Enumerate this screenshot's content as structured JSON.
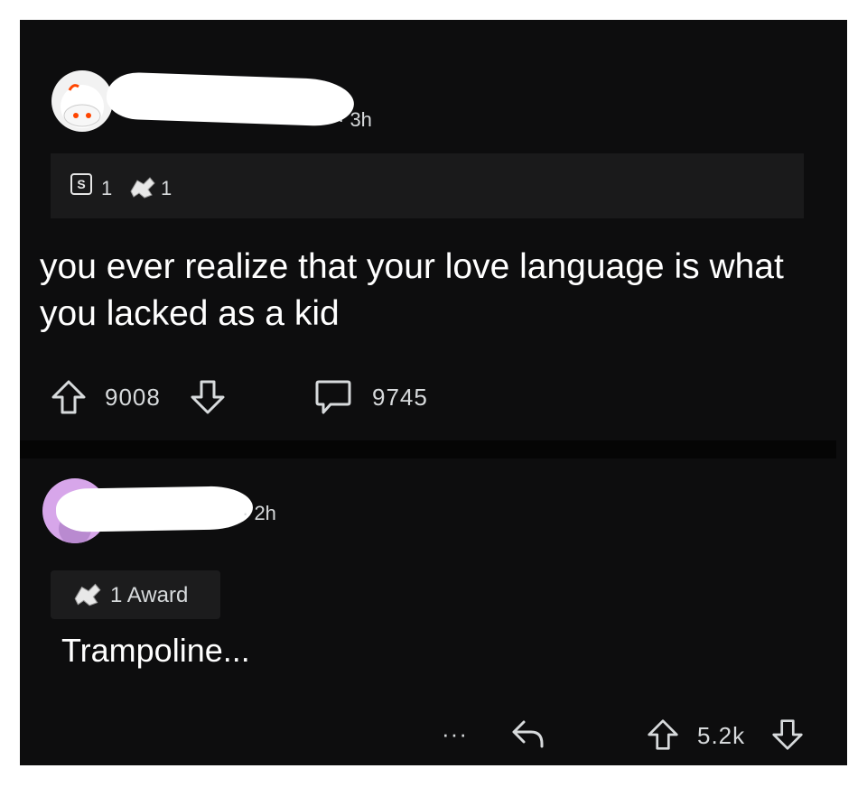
{
  "post": {
    "time": "· 3h",
    "awards": {
      "silver_count": "1",
      "helpful_count": "1"
    },
    "title": "you ever realize that your love language is what you lacked as a kid",
    "upvotes": "9008",
    "comments": "9745"
  },
  "comment": {
    "time": "· 2h",
    "award_label": "1 Award",
    "text": "Trampoline...",
    "more": "···",
    "score": "5.2k"
  },
  "colors": {
    "background": "#0d0d0e",
    "award_bar": "#1a1a1b",
    "text": "#d7dadc",
    "avatar2": "#d7a6ea"
  }
}
